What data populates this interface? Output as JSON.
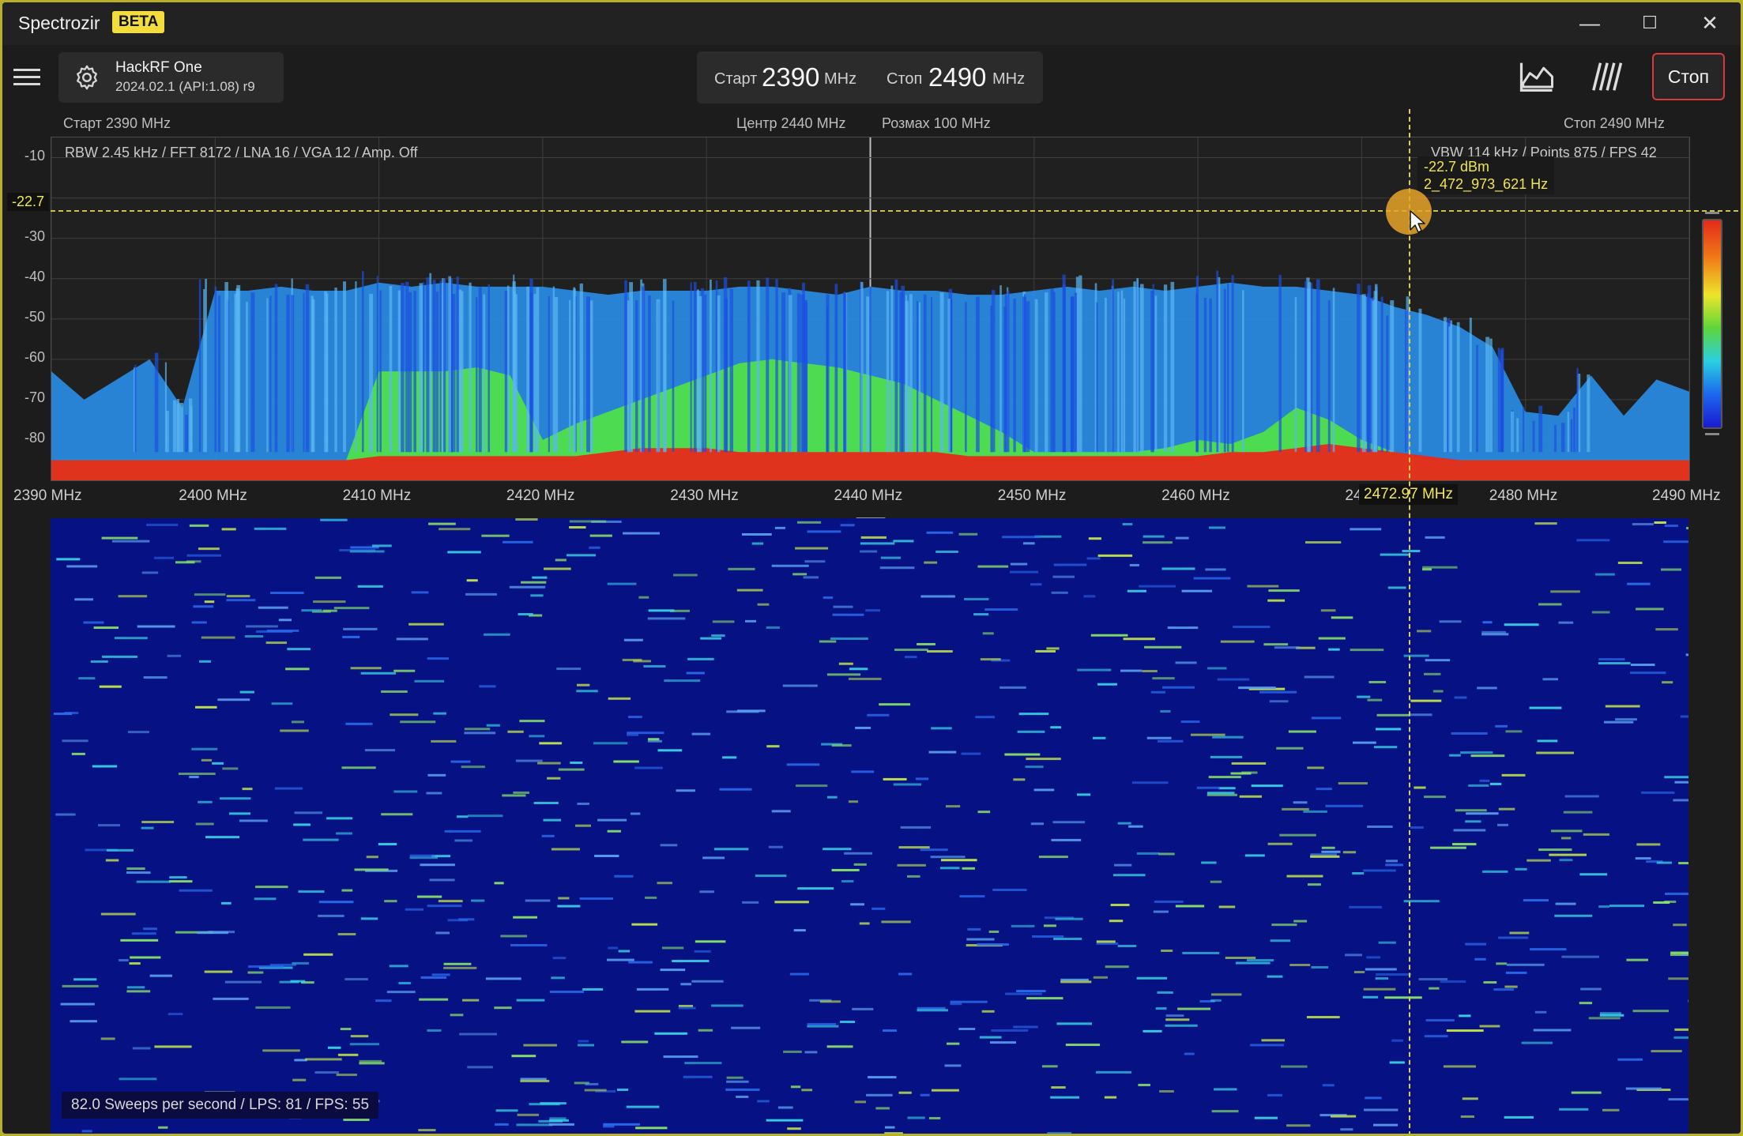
{
  "app": {
    "title": "Spectrozir",
    "badge": "BETA"
  },
  "window_controls": {
    "minimize": "—",
    "maximize": "☐",
    "close": "✕"
  },
  "device": {
    "name": "HackRF One",
    "firmware": "2024.02.1 (API:1.08) r9"
  },
  "range": {
    "start_label": "Старт",
    "start_value": "2390",
    "start_unit": "MHz",
    "stop_label": "Стоп",
    "stop_value": "2490",
    "stop_unit": "MHz"
  },
  "toolbar": {
    "stop_button": "Стоп",
    "spectrum_icon": "area-chart-icon",
    "waterfall_icon": "waterfall-icon"
  },
  "spectrum": {
    "start_text": "Старт 2390 MHz",
    "center_text": "Центр 2440 MHz",
    "span_text": "Розмах 100 MHz",
    "stop_text": "Стоп 2490 MHz",
    "left_info": "RBW 2.45 kHz / FFT 8172 / LNA 16 / VGA 12 / Amp. Off",
    "right_info": "VBW 114 kHz / Points 875 / FPS 42",
    "marker_level": "-22.7 dBm",
    "marker_freq": "2_472_973_621 Hz",
    "level_badge": "-22.7",
    "freq_badge": "2472.97 MHz",
    "y_ticks": [
      "-10",
      "-20",
      "-30",
      "-40",
      "-50",
      "-60",
      "-70",
      "-80"
    ],
    "x_ticks": [
      "2390 MHz",
      "2400 MHz",
      "2410 MHz",
      "2420 MHz",
      "2430 MHz",
      "2440 MHz",
      "2450 MHz",
      "2460 MHz",
      "2470",
      "2480 MHz",
      "2490 MHz"
    ]
  },
  "chart_data": {
    "type": "area",
    "xlabel": "",
    "ylabel": "",
    "xlim": [
      2390,
      2490
    ],
    "ylim": [
      -90,
      -5
    ],
    "x_unit": "MHz",
    "y_unit": "dBm",
    "x": [
      2390,
      2392,
      2394,
      2396,
      2398,
      2400,
      2402,
      2404,
      2406,
      2408,
      2410,
      2412,
      2414,
      2416,
      2418,
      2420,
      2422,
      2424,
      2426,
      2428,
      2430,
      2432,
      2434,
      2436,
      2438,
      2440,
      2442,
      2444,
      2446,
      2448,
      2450,
      2452,
      2454,
      2456,
      2458,
      2460,
      2462,
      2464,
      2466,
      2468,
      2470,
      2472,
      2474,
      2476,
      2478,
      2480,
      2482,
      2484,
      2486,
      2488,
      2490
    ],
    "series": [
      {
        "values": [
          -63,
          -70,
          -65,
          -60,
          -72,
          -43,
          -43,
          -42,
          -43,
          -43,
          -41,
          -42,
          -41,
          -42,
          -42,
          -42,
          -43,
          -44,
          -43,
          -43,
          -43,
          -42,
          -42,
          -43,
          -44,
          -42,
          -43,
          -43,
          -44,
          -44,
          -43,
          -42,
          -43,
          -42,
          -43,
          -42,
          -41,
          -42,
          -42,
          -43,
          -44,
          -47,
          -49,
          -52,
          -57,
          -73,
          -74,
          -64,
          -74,
          -65,
          -68
        ]
      },
      {
        "values": [
          -85,
          -85,
          -85,
          -85,
          -85,
          -85,
          -85,
          -85,
          -85,
          -85,
          -63,
          -63,
          -63,
          -62,
          -64,
          -80,
          -76,
          -73,
          -70,
          -67,
          -64,
          -61,
          -60,
          -61,
          -62,
          -64,
          -66,
          -70,
          -74,
          -78,
          -83,
          -83,
          -83,
          -83,
          -82,
          -80,
          -81,
          -78,
          -72,
          -75,
          -80,
          -83,
          -85,
          -85,
          -85,
          -85,
          -85,
          -85,
          -85,
          -85,
          -85
        ]
      },
      {
        "values": [
          -85,
          -85,
          -85,
          -85,
          -85,
          -85,
          -85,
          -85,
          -85,
          -85,
          -84,
          -84,
          -84,
          -84,
          -84,
          -84,
          -84,
          -83,
          -82,
          -82,
          -82,
          -83,
          -83,
          -83,
          -83,
          -83,
          -83,
          -83,
          -84,
          -84,
          -84,
          -84,
          -84,
          -84,
          -84,
          -84,
          -83,
          -83,
          -82,
          -81,
          -82,
          -83,
          -84,
          -85,
          -85,
          -85,
          -85,
          -85,
          -85,
          -85,
          -85
        ]
      }
    ]
  },
  "waterfall": {
    "stats_text": "82.0 Sweeps per second / LPS: 81 / FPS: 55"
  }
}
